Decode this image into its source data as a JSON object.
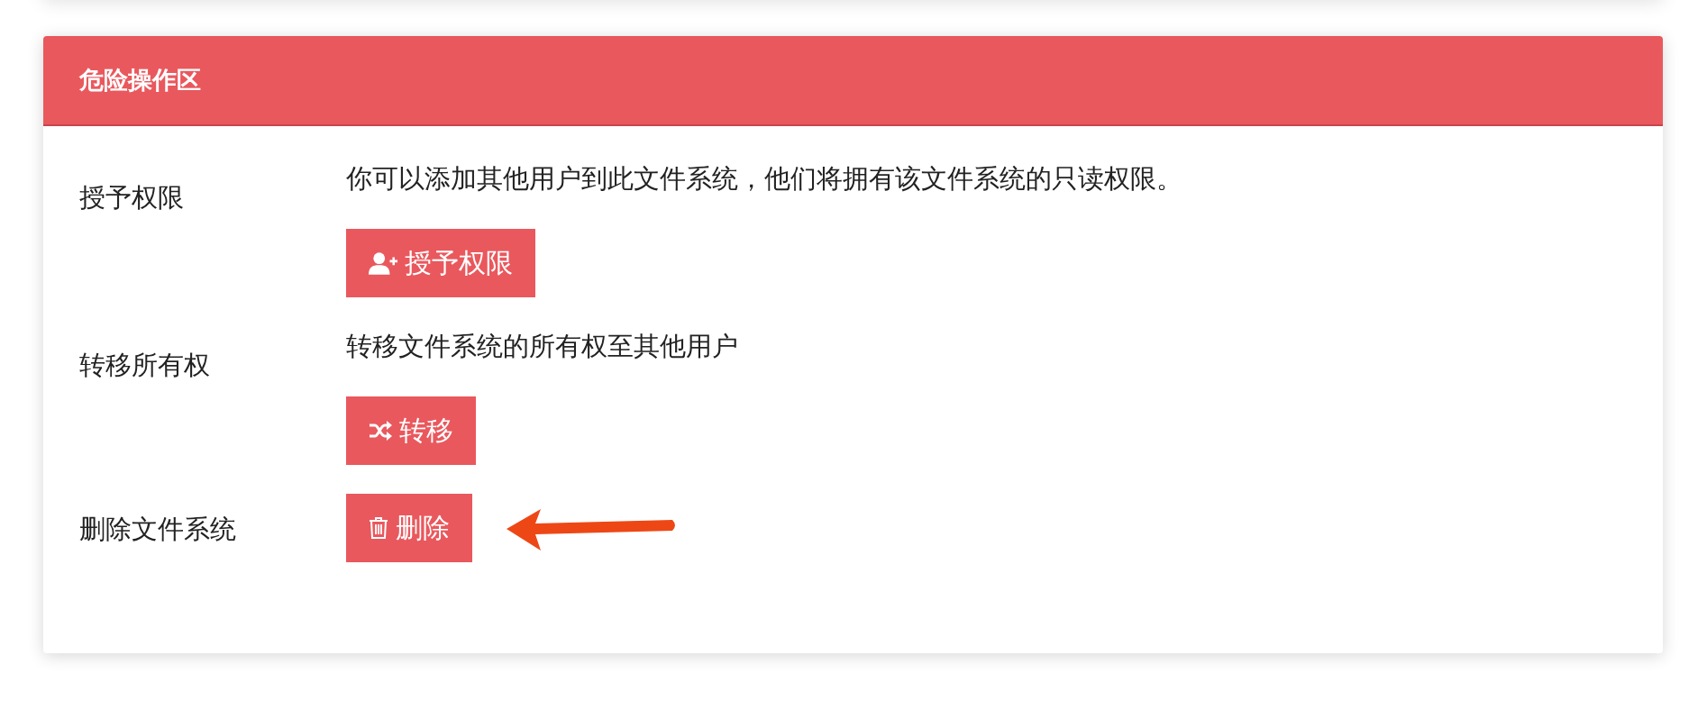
{
  "panel": {
    "title": "危险操作区",
    "rows": [
      {
        "label": "授予权限",
        "description": "你可以添加其他用户到此文件系统，他们将拥有该文件系统的只读权限。",
        "button": {
          "kind": "user-plus",
          "label": "授予权限"
        }
      },
      {
        "label": "转移所有权",
        "description": "转移文件系统的所有权至其他用户",
        "button": {
          "kind": "shuffle",
          "label": "转移"
        }
      },
      {
        "label": "删除文件系统",
        "button": {
          "kind": "trash",
          "label": "删除"
        }
      }
    ]
  }
}
